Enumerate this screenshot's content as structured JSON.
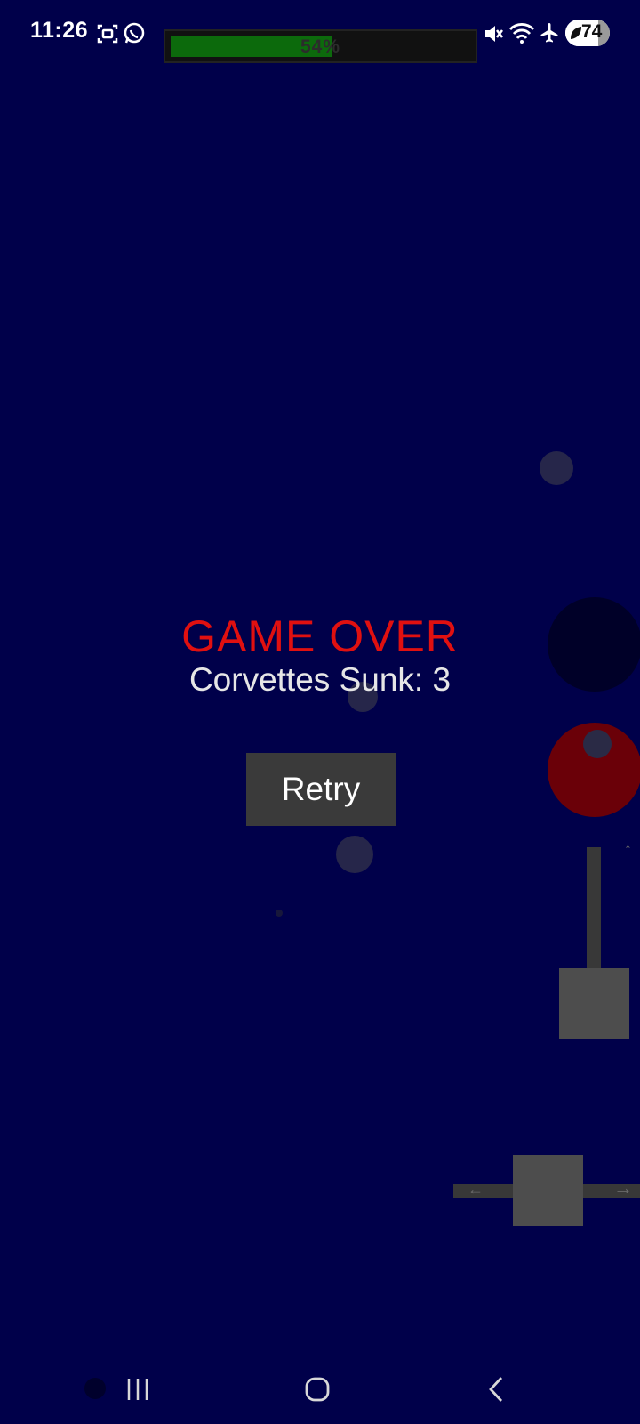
{
  "status_bar": {
    "time": "11:26",
    "battery_level": "74",
    "icons": [
      "screenshot-icon",
      "whatsapp-icon",
      "mute-icon",
      "wifi-icon",
      "airplane-icon",
      "battery-icon"
    ]
  },
  "progress": {
    "label": "54%",
    "fraction": 0.54,
    "fill_color": "#0c6a0c"
  },
  "game_over": {
    "title": "GAME OVER",
    "score_text": "Corvettes Sunk: 3",
    "retry_label": "Retry"
  },
  "controls": {
    "up_arrow": "↑",
    "left_arrow": "←",
    "right_arrow": "→"
  },
  "colors": {
    "background": "#00004a",
    "title": "#e01010",
    "enemy": "#6a0008"
  }
}
